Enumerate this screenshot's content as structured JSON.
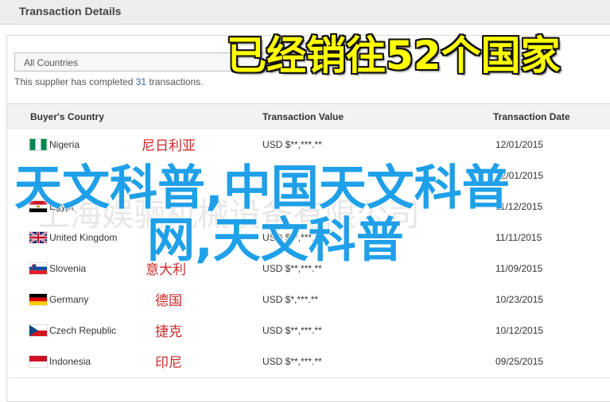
{
  "header": {
    "title": "Transaction Details"
  },
  "filter": {
    "selected": "All Countries"
  },
  "summary": {
    "prefix": "This supplier has completed ",
    "count": "31",
    "suffix": " transactions."
  },
  "table": {
    "columns": [
      "Buyer's Country",
      "Transaction Value",
      "Transaction Date"
    ],
    "rows": [
      {
        "country": "Nigeria",
        "flag": "nigeria-flag",
        "value": "USD $**,***.**",
        "date": "12/01/2015",
        "cn": "尼日利亚"
      },
      {
        "country": "",
        "flag": "",
        "value": "",
        "date": "12/01/2015",
        "cn": ""
      },
      {
        "country": "Egypt",
        "flag": "egypt-flag",
        "value": "",
        "date": "11/12/2015",
        "cn": ""
      },
      {
        "country": "United Kingdom",
        "flag": "uk-flag",
        "value": "USD $**,***.**",
        "date": "11/11/2015",
        "cn": ""
      },
      {
        "country": "Slovenia",
        "flag": "slovenia-flag",
        "value": "USD $**,***.**",
        "date": "11/09/2015",
        "cn": "意大利"
      },
      {
        "country": "Germany",
        "flag": "germany-flag",
        "value": "USD $*,***.**",
        "date": "10/23/2015",
        "cn": "德国"
      },
      {
        "country": "Czech Republic",
        "flag": "czech-flag",
        "value": "USD $**,***.**",
        "date": "10/12/2015",
        "cn": "捷克"
      },
      {
        "country": "Indonesia",
        "flag": "indonesia-flag",
        "value": "USD $**,***.**",
        "date": "09/25/2015",
        "cn": "印尼"
      }
    ]
  },
  "overlays": {
    "banner": "已经销往52个国家",
    "line1": "天文科普,中国天文科普",
    "line2": "网,天文科普",
    "watermark": "上海娱骊机械设备有限公司"
  },
  "colors": {
    "banner_fill": "#ffff00",
    "overlay_blue": "#1fa0e8",
    "cn_label_red": "#cc2a2a",
    "count_blue": "#3366aa"
  }
}
